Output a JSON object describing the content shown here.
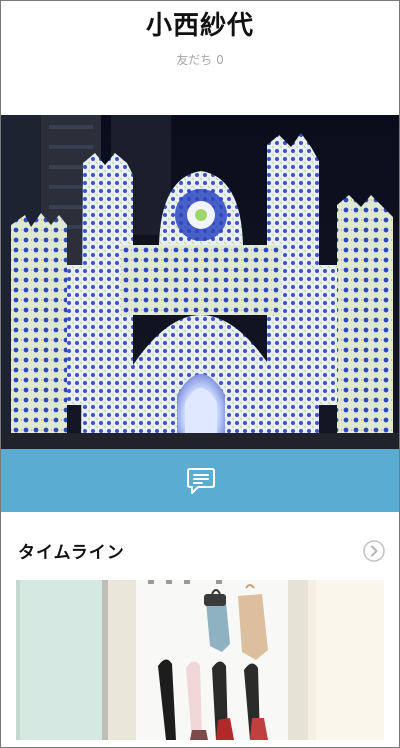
{
  "profile": {
    "name": "小西紗代",
    "friends_label": "友だち 0"
  },
  "cover": {
    "icon": "illumination-cover-photo"
  },
  "action_bar": {
    "chat_icon": "chat-bubble-icon",
    "color": "#5bacd1"
  },
  "timeline": {
    "title": "タイムライン",
    "arrow_icon": "chevron-right-circle-icon"
  },
  "timeline_photo": {
    "icon": "umbrellas-photo"
  }
}
